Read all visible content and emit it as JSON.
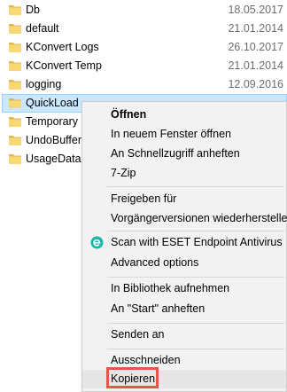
{
  "files": [
    {
      "name": "Db",
      "date": "18.05.2017"
    },
    {
      "name": "default",
      "date": "21.01.2014"
    },
    {
      "name": "KConvert Logs",
      "date": "26.10.2017"
    },
    {
      "name": "KConvert Temp",
      "date": "21.01.2014"
    },
    {
      "name": "logging",
      "date": "12.09.2016"
    },
    {
      "name": "QuickLoad",
      "date": ""
    },
    {
      "name": "Temporary I",
      "date": ""
    },
    {
      "name": "UndoBuffer",
      "date": ""
    },
    {
      "name": "UsageData",
      "date": ""
    }
  ],
  "context_menu": {
    "open": "Öffnen",
    "open_new_window": "In neuem Fenster öffnen",
    "pin_quick_access": "An Schnellzugriff anheften",
    "seven_zip": "7-Zip",
    "share_with": "Freigeben für",
    "restore_previous": "Vorgängerversionen wiederherstellen",
    "eset_scan": "Scan with ESET Endpoint Antivirus",
    "advanced_options": "Advanced options",
    "include_library": "In Bibliothek aufnehmen",
    "pin_start": "An \"Start\" anheften",
    "send_to": "Senden an",
    "cut": "Ausschneiden",
    "copy": "Kopieren"
  },
  "colors": {
    "selection_bg": "#cce8ff",
    "highlight_border": "#e8534a",
    "folder_yellow": "#f8d775",
    "eset_teal": "#1fb5a8"
  }
}
